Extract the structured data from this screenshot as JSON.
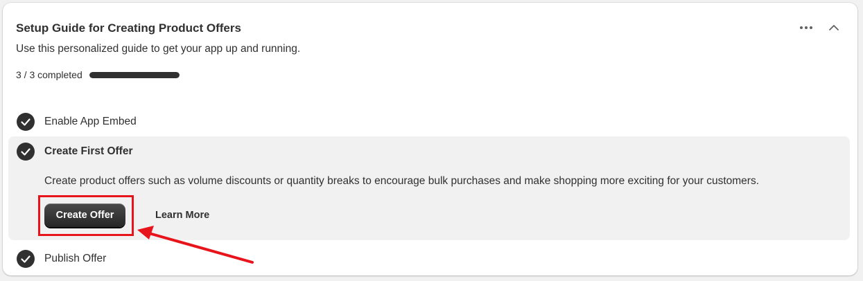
{
  "guide": {
    "title": "Setup Guide for Creating Product Offers",
    "subtitle": "Use this personalized guide to get your app up and running.",
    "more_icon": "more-horizontal-icon",
    "collapse_icon": "chevron-up-icon"
  },
  "progress": {
    "text": "3 / 3 completed",
    "fraction": 1.0,
    "fill_color": "#303030"
  },
  "steps": [
    {
      "label": "Enable App Embed",
      "icon": "check-circle-icon",
      "completed": true
    },
    {
      "label": "Create First Offer",
      "icon": "check-circle-icon",
      "completed": true,
      "expanded": true,
      "description": "Create product offers such as volume discounts or quantity breaks to encourage bulk purchases and make shopping more exciting for your customers.",
      "primary_action": "Create Offer",
      "secondary_action": "Learn More"
    },
    {
      "label": "Publish Offer",
      "icon": "check-circle-icon",
      "completed": true
    }
  ],
  "annotation": {
    "color": "#e8141b",
    "type": "red-box-and-arrow"
  }
}
